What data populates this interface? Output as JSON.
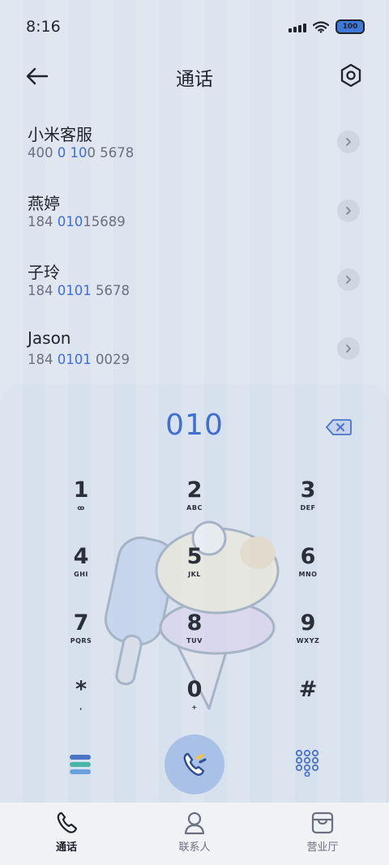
{
  "status_bar": {
    "time": "8:16",
    "battery": "100"
  },
  "header": {
    "title": "通话"
  },
  "results": [
    {
      "name": "小米客服",
      "num_parts": [
        "400 ",
        "0",
        " ",
        "10",
        "0 5678"
      ]
    },
    {
      "name": "燕婷",
      "num_parts": [
        "184 ",
        "010",
        "15689",
        "",
        ""
      ]
    },
    {
      "name": "子玲",
      "num_parts": [
        "184 ",
        "0101",
        " 5678",
        "",
        ""
      ]
    },
    {
      "name": "Jason",
      "num_parts": [
        "184 ",
        "0101",
        " 0029",
        "",
        ""
      ]
    }
  ],
  "dial": {
    "input": "010",
    "keys": [
      {
        "digit": "1",
        "letters": "ꝏ"
      },
      {
        "digit": "2",
        "letters": "ABC"
      },
      {
        "digit": "3",
        "letters": "DEF"
      },
      {
        "digit": "4",
        "letters": "GHI"
      },
      {
        "digit": "5",
        "letters": "JKL"
      },
      {
        "digit": "6",
        "letters": "MNO"
      },
      {
        "digit": "7",
        "letters": "PQRS"
      },
      {
        "digit": "8",
        "letters": "TUV"
      },
      {
        "digit": "9",
        "letters": "WXYZ"
      },
      {
        "digit": "*",
        "letters": ","
      },
      {
        "digit": "0",
        "letters": "+"
      },
      {
        "digit": "#",
        "letters": ""
      }
    ]
  },
  "bottom_nav": [
    {
      "label": "通话",
      "icon": "phone-icon",
      "active": true
    },
    {
      "label": "联系人",
      "icon": "contacts-icon",
      "active": false
    },
    {
      "label": "营业厅",
      "icon": "store-icon",
      "active": false
    }
  ],
  "colors": {
    "accent": "#3f6fd1",
    "call_button": "#a9c1e6"
  }
}
